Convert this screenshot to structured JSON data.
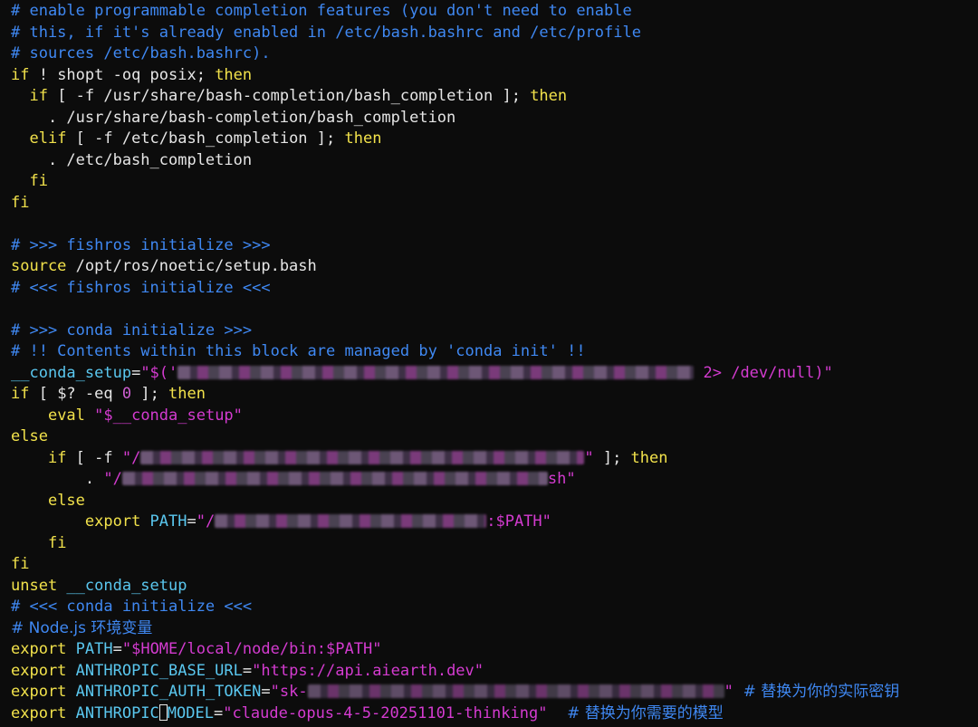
{
  "colors": {
    "background": "#0c0c0c",
    "comment": "#3f88f2",
    "keyword": "#f2e24b",
    "string": "#d43bd0",
    "variable": "#5ac7ef",
    "text": "#e6e6e6"
  },
  "lines": [
    {
      "comment": "# enable programmable completion features (you don't need to enable"
    },
    {
      "comment": "# this, if it's already enabled in /etc/bash.bashrc and /etc/profile"
    },
    {
      "comment": "# sources /etc/bash.bashrc)."
    },
    {
      "kw1": "if",
      "plain1": " ! shopt -oq posix; ",
      "kw2": "then"
    },
    {
      "indent": "  ",
      "kw1": "if",
      "plain1": " [ -f /usr/share/bash-completion/bash_completion ]; ",
      "kw2": "then"
    },
    {
      "plain1": "    . /usr/share/bash-completion/bash_completion"
    },
    {
      "indent": "  ",
      "kw1": "elif",
      "plain1": " [ -f /etc/bash_completion ]; ",
      "kw2": "then"
    },
    {
      "plain1": "    . /etc/bash_completion"
    },
    {
      "indent": "  ",
      "kw1": "fi"
    },
    {
      "kw1": "fi"
    },
    {},
    {
      "comment": "# >>> fishros initialize >>>"
    },
    {
      "kw1": "source",
      "plain1": " /opt/ros/noetic/setup.bash"
    },
    {
      "comment": "# <<< fishros initialize <<<"
    },
    {},
    {
      "comment": "# >>> conda initialize >>>"
    },
    {
      "comment": "# !! Contents within this block are managed by 'conda init' !!"
    },
    {
      "var": "__conda_setup",
      "plain": "=",
      "str1": "\"$('",
      "str2": " 2> /dev/null)\""
    },
    {
      "kw1": "if",
      "plain1": " [ $? -eq ",
      "num": "0",
      "plain2": " ]; ",
      "kw2": "then"
    },
    {
      "indent": "    ",
      "kw1": "eval",
      "str1": " \"$__conda_setup\""
    },
    {
      "kw1": "else"
    },
    {
      "indent": "    ",
      "kw1": "if",
      "plain1": " [ -f ",
      "str1": "\"/",
      "str2": "\"",
      "plain2": " ]; ",
      "kw2": "then"
    },
    {
      "indent": "        ",
      "plain1": ". ",
      "str1": "\"/",
      "str2": "sh\""
    },
    {
      "indent": "    ",
      "kw1": "else"
    },
    {
      "indent": "        ",
      "kw1": "export",
      "var": " PATH",
      "plain1": "=",
      "str1": "\"/",
      "str2": ":$PATH\""
    },
    {
      "indent": "    ",
      "kw1": "fi"
    },
    {
      "kw1": "fi"
    },
    {
      "kw1": "unset",
      "var": " __conda_setup"
    },
    {
      "comment": "# <<< conda initialize <<<"
    },
    {
      "comment": "# Node.js 环境变量"
    },
    {
      "kw1": "export",
      "var": " PATH",
      "plain1": "=",
      "str1": "\"$HOME/local/node/bin:$PATH\""
    },
    {
      "kw1": "export",
      "var": " ANTHROPIC_BASE_URL",
      "plain1": "=",
      "str1": "\"https://api.aiearth.dev\""
    },
    {
      "kw1": "export",
      "var": " ANTHROPIC_AUTH_TOKEN",
      "plain1": "=",
      "str1": "\"sk-",
      "str2": "\"",
      "comment": "  # 替换为你的实际密钥"
    },
    {
      "kw1": "export",
      "var": " ANTHROPIC",
      "var2": "MODEL",
      "plain1": "=",
      "str1": "\"claude-opus-4-5-20251101-thinking\"",
      "comment": "    # 替换为你需要的模型"
    }
  ]
}
